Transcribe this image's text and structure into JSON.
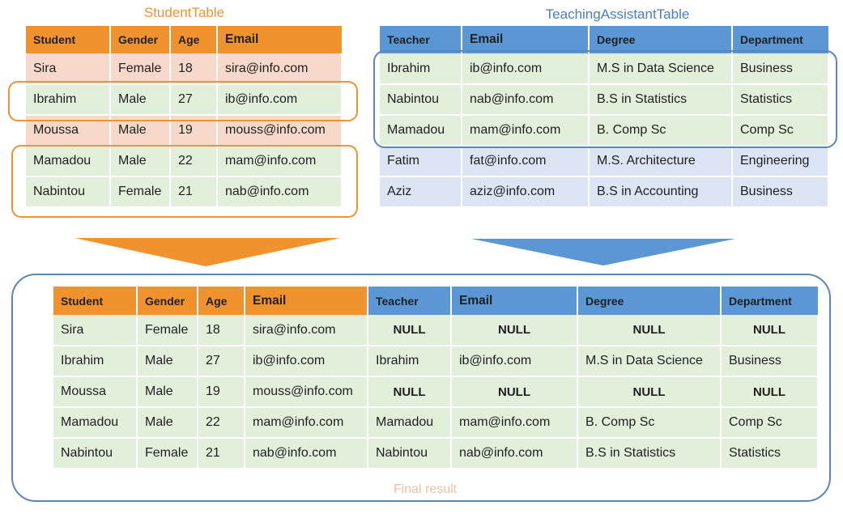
{
  "student_table": {
    "title": "StudentTable",
    "headers": [
      "Student",
      "Gender",
      "Age",
      "Email"
    ],
    "rows": [
      [
        "Sira",
        "Female",
        "18",
        "sira@info.com"
      ],
      [
        "Ibrahim",
        "Male",
        "27",
        "ib@info.com"
      ],
      [
        "Moussa",
        "Male",
        "19",
        "mouss@info.com"
      ],
      [
        "Mamadou",
        "Male",
        "22",
        "mam@info.com"
      ],
      [
        "Nabintou",
        "Female",
        "21",
        "nab@info.com"
      ]
    ]
  },
  "ta_table": {
    "title": "TeachingAssistantTable",
    "headers": [
      "Teacher",
      "Email",
      "Degree",
      "Department"
    ],
    "rows": [
      [
        "Ibrahim",
        "ib@info.com",
        "M.S in Data Science",
        "Business"
      ],
      [
        "Nabintou",
        "nab@info.com",
        "B.S in Statistics",
        "Statistics"
      ],
      [
        "Mamadou",
        "mam@info.com",
        "B. Comp Sc",
        "Comp Sc"
      ],
      [
        "Fatim",
        "fat@info.com",
        "M.S. Architecture",
        "Engineering"
      ],
      [
        "Aziz",
        "aziz@info.com",
        "B.S in Accounting",
        "Business"
      ]
    ]
  },
  "result_table": {
    "caption": "Final result",
    "headers": [
      "Student",
      "Gender",
      "Age",
      "Email",
      "Teacher",
      "Email",
      "Degree",
      "Department"
    ],
    "rows": [
      [
        "Sira",
        "Female",
        "18",
        "sira@info.com",
        "NULL",
        "NULL",
        "NULL",
        "NULL"
      ],
      [
        "Ibrahim",
        "Male",
        "27",
        "ib@info.com",
        "Ibrahim",
        "ib@info.com",
        "M.S in Data Science",
        "Business"
      ],
      [
        "Moussa",
        "Male",
        "19",
        "mouss@info.com",
        "NULL",
        "NULL",
        "NULL",
        "NULL"
      ],
      [
        "Mamadou",
        "Male",
        "22",
        "mam@info.com",
        "Mamadou",
        "mam@info.com",
        "B. Comp Sc",
        "Comp Sc"
      ],
      [
        "Nabintou",
        "Female",
        "21",
        "nab@info.com",
        "Nabintou",
        "nab@info.com",
        "B.S in Statistics",
        "Statistics"
      ]
    ]
  },
  "colors": {
    "orange": "#f0932f",
    "blue": "#5b97d4",
    "row_pink": "#f7d9cc",
    "row_green": "#e2efda",
    "row_blue": "#dbe5f3",
    "frame_blue": "#5a86bd"
  }
}
